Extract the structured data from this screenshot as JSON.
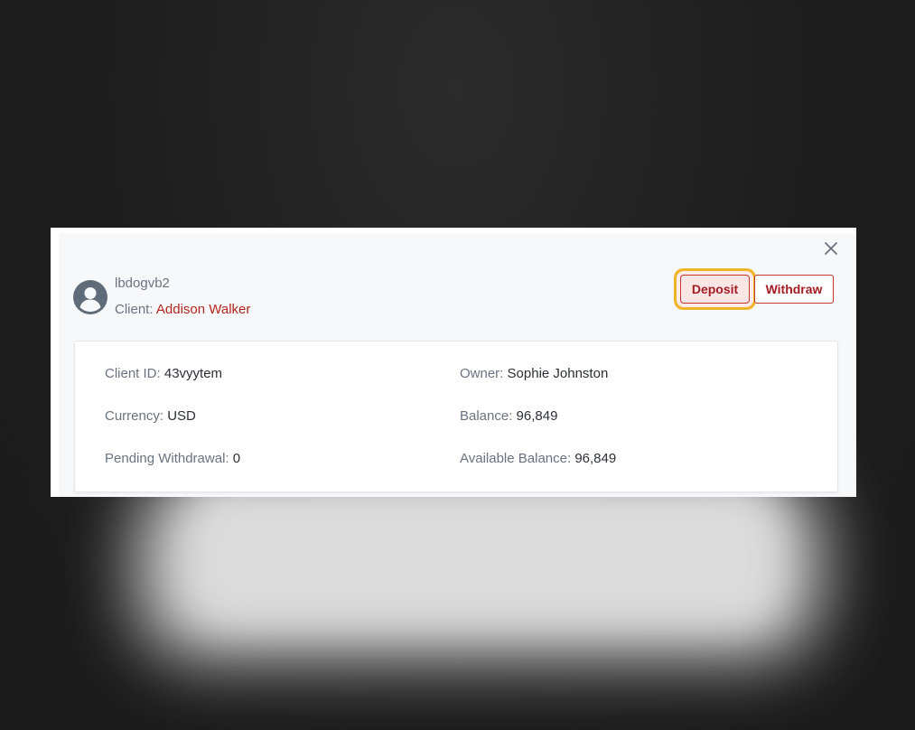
{
  "dialog": {
    "username": "lbdogvb2",
    "client_label": "Client:",
    "client_name": "Addison Walker",
    "close_icon": "close-icon",
    "avatar_icon": "user-avatar-icon"
  },
  "actions": {
    "deposit_label": "Deposit",
    "withdraw_label": "Withdraw"
  },
  "details": {
    "client_id": {
      "label": "Client ID:",
      "value": "43vyytem"
    },
    "owner": {
      "label": "Owner:",
      "value": "Sophie Johnston"
    },
    "currency": {
      "label": "Currency:",
      "value": "USD"
    },
    "balance": {
      "label": "Balance:",
      "value": "96,849"
    },
    "pending_withdrawal": {
      "label": "Pending Withdrawal:",
      "value": "0"
    },
    "available_balance": {
      "label": "Available Balance:",
      "value": "96,849"
    }
  },
  "colors": {
    "accent_red": "#a51d24",
    "focus_ring": "#f0b429",
    "muted_text": "#6b7280"
  }
}
